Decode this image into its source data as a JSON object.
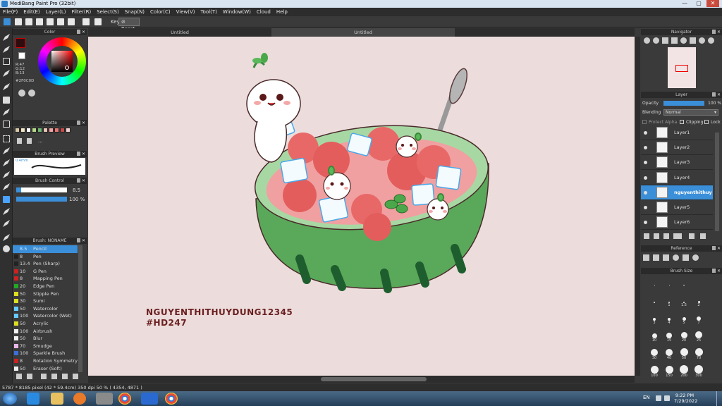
{
  "title_bar": {
    "app_title": "MediBang Paint Pro (32bit)",
    "minimize": "—",
    "maximize": "▢",
    "close": "✕"
  },
  "menu": [
    "File(F)",
    "Edit(E)",
    "Layer(L)",
    "Filter(R)",
    "Select(S)",
    "Snap(N)",
    "Color(C)",
    "View(V)",
    "Tool(T)",
    "Window(W)",
    "Cloud",
    "Help"
  ],
  "toolbar": {
    "key_label": "Key",
    "reset_label": "Reset"
  },
  "color_panel": {
    "title": "Color",
    "r": "R:47",
    "g": "G:12",
    "b": "B:13",
    "hex": "#2F0C0D",
    "primary_color": "#2f0c0d"
  },
  "palette_panel": {
    "title": "Palette",
    "swatches": [
      "#d9c9a8",
      "#f2e5c9",
      "#ffffff",
      "#b9d98a",
      "#6fb870",
      "#e9c6b6",
      "#f4a4a4",
      "#e87474",
      "#c24a4a",
      "#f3d1d1"
    ],
    "more": "..."
  },
  "brush_preview": {
    "title": "Brush Preview",
    "size_label": "0.4mm"
  },
  "brush_control": {
    "title": "Brush Control",
    "size_value": "8.5",
    "opacity_value": "100 %"
  },
  "brush_list": {
    "title": "Brush: NONAME",
    "items": [
      {
        "size": "8.5",
        "name": "Pencil",
        "color": "#3b8fd9"
      },
      {
        "size": "8",
        "name": "Pen",
        "color": "#222222"
      },
      {
        "size": "13.4",
        "name": "Pen (Sharp)",
        "color": "#222222"
      },
      {
        "size": "10",
        "name": "G Pen",
        "color": "#cc2222"
      },
      {
        "size": "8",
        "name": "Mapping Pen",
        "color": "#cc2222"
      },
      {
        "size": "20",
        "name": "Edge Pen",
        "color": "#22aa22"
      },
      {
        "size": "50",
        "name": "Stipple Pen",
        "color": "#dddd22"
      },
      {
        "size": "30",
        "name": "Sumi",
        "color": "#dddd22"
      },
      {
        "size": "50",
        "name": "Watercolor",
        "color": "#66ccff"
      },
      {
        "size": "100",
        "name": "Watercolor (Wet)",
        "color": "#66ccff"
      },
      {
        "size": "50",
        "name": "Acrylic",
        "color": "#dddd22"
      },
      {
        "size": "100",
        "name": "Airbrush",
        "color": "#f0f0f0"
      },
      {
        "size": "50",
        "name": "Blur",
        "color": "#f0f0f0"
      },
      {
        "size": "70",
        "name": "Smudge",
        "color": "#e8b8e8"
      },
      {
        "size": "100",
        "name": "Sparkle Brush",
        "color": "#3b6fd9"
      },
      {
        "size": "8",
        "name": "Rotation Symmetry P",
        "color": "#cc2222"
      },
      {
        "size": "50",
        "name": "Eraser (Soft)",
        "color": "#f0f0f0"
      }
    ]
  },
  "tabs": [
    {
      "label": "Untitled"
    },
    {
      "label": "Untitled"
    }
  ],
  "watermark": {
    "line1": "NGUYENTHITHUYDUNG12345",
    "line2": "#HD247"
  },
  "navigator": {
    "title": "Navigator"
  },
  "layer_panel": {
    "title": "Layer",
    "opacity_label": "Opacity",
    "opacity_value": "100 %",
    "blending_label": "Blending",
    "blending_value": "Normal",
    "protect_alpha": "Protect Alpha",
    "clipping": "Clipping",
    "lock": "Lock",
    "layers": [
      {
        "name": "Layer1",
        "selected": false
      },
      {
        "name": "Layer2",
        "selected": false
      },
      {
        "name": "Layer3",
        "selected": false
      },
      {
        "name": "Layer4",
        "selected": false
      },
      {
        "name": "nguyenthithuy",
        "selected": true
      },
      {
        "name": "Layer5",
        "selected": false
      },
      {
        "name": "Layer6",
        "selected": false
      }
    ]
  },
  "reference_panel": {
    "title": "Reference"
  },
  "brush_size_panel": {
    "title": "Brush Size",
    "sizes": [
      "",
      "",
      "",
      "",
      "1",
      "1.5",
      "2",
      "3",
      "4",
      "5",
      "7",
      "10",
      "15",
      "20",
      "25",
      "30",
      "40",
      "50",
      "70",
      "100",
      "150",
      "200",
      "300"
    ]
  },
  "status_bar": {
    "text": "5787 * 8185 pixel  (42 * 59.4cm)  350 dpi  50 %  ( 4354, 4871 )"
  },
  "taskbar": {
    "lang": "EN",
    "time": "9:22 PM",
    "date": "7/29/2022"
  }
}
